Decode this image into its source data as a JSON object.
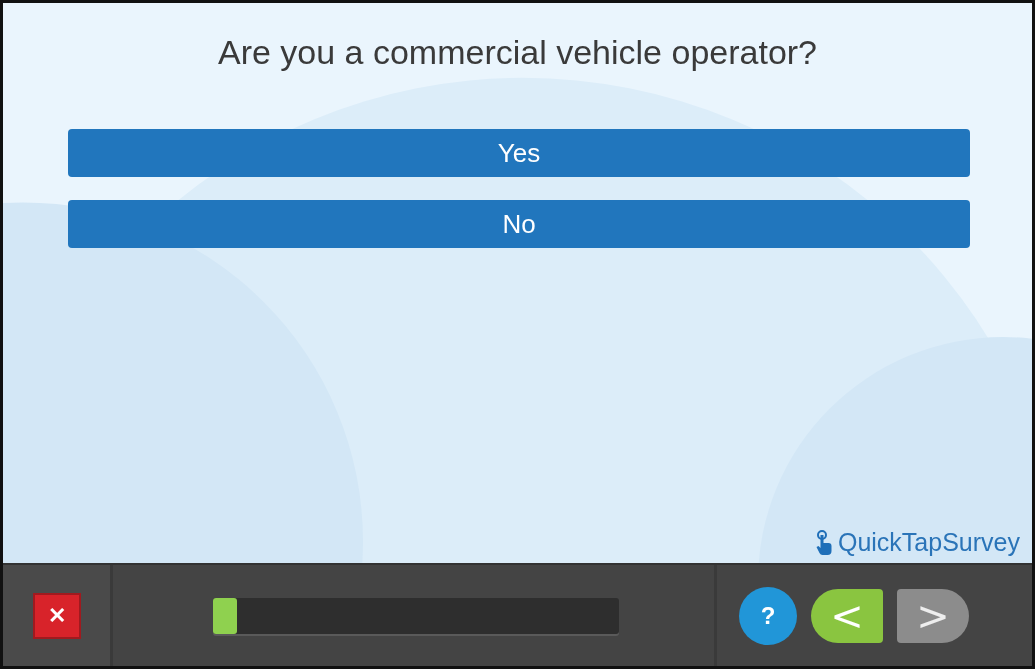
{
  "question": "Are you a commercial vehicle operator?",
  "answers": [
    {
      "label": "Yes",
      "selected": false
    },
    {
      "label": "No",
      "selected": false
    }
  ],
  "brand": "QuickTapSurvey",
  "toolbar": {
    "close": "✕",
    "progress": {
      "level": 0.06
    },
    "help": "?",
    "nav": [
      {
        "kind": "back",
        "label": "<",
        "disabled": false
      },
      {
        "kind": "next",
        "label": ">",
        "disabled": true
      }
    ]
  }
}
